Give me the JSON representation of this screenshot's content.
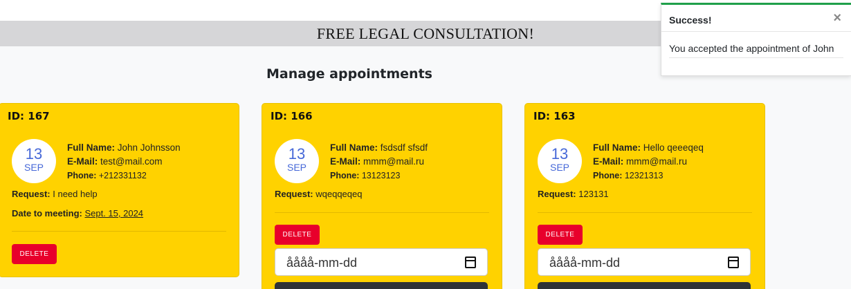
{
  "banner": {
    "title": "FREE LEGAL CONSULTATION!"
  },
  "page": {
    "heading": "Manage appointments"
  },
  "labels": {
    "full_name": "Full Name:",
    "email": "E-Mail:",
    "phone": "Phone:",
    "request": "Request:",
    "date_to_meeting": "Date to meeting:",
    "delete": "DELETE",
    "date_placeholder": "åååå-mm-dd"
  },
  "appointments": [
    {
      "id": "ID: 167",
      "day": "13",
      "month": "SEP",
      "full_name": "John Johnsson",
      "email": "test@mail.com",
      "phone": "+212331132",
      "request": "I need help",
      "meeting_date": "Sept. 15, 2024"
    },
    {
      "id": "ID: 166",
      "day": "13",
      "month": "SEP",
      "full_name": "fsdsdf sfsdf",
      "email": "mmm@mail.ru",
      "phone": "13123123",
      "request": "wqeqqeqeq"
    },
    {
      "id": "ID: 163",
      "day": "13",
      "month": "SEP",
      "full_name": "Hello qeeeqeq",
      "email": "mmm@mail.ru",
      "phone": "12321313",
      "request": "123131"
    }
  ],
  "toast": {
    "title": "Success!",
    "close": "×",
    "message": "You accepted the appointment of John"
  },
  "colors": {
    "card": "#ffd200",
    "delete": "#e8002b",
    "date_text": "#4668d8",
    "toast_accent": "#1fa04a"
  },
  "icons": {
    "calendar": "calendar-icon",
    "close": "close-icon"
  }
}
